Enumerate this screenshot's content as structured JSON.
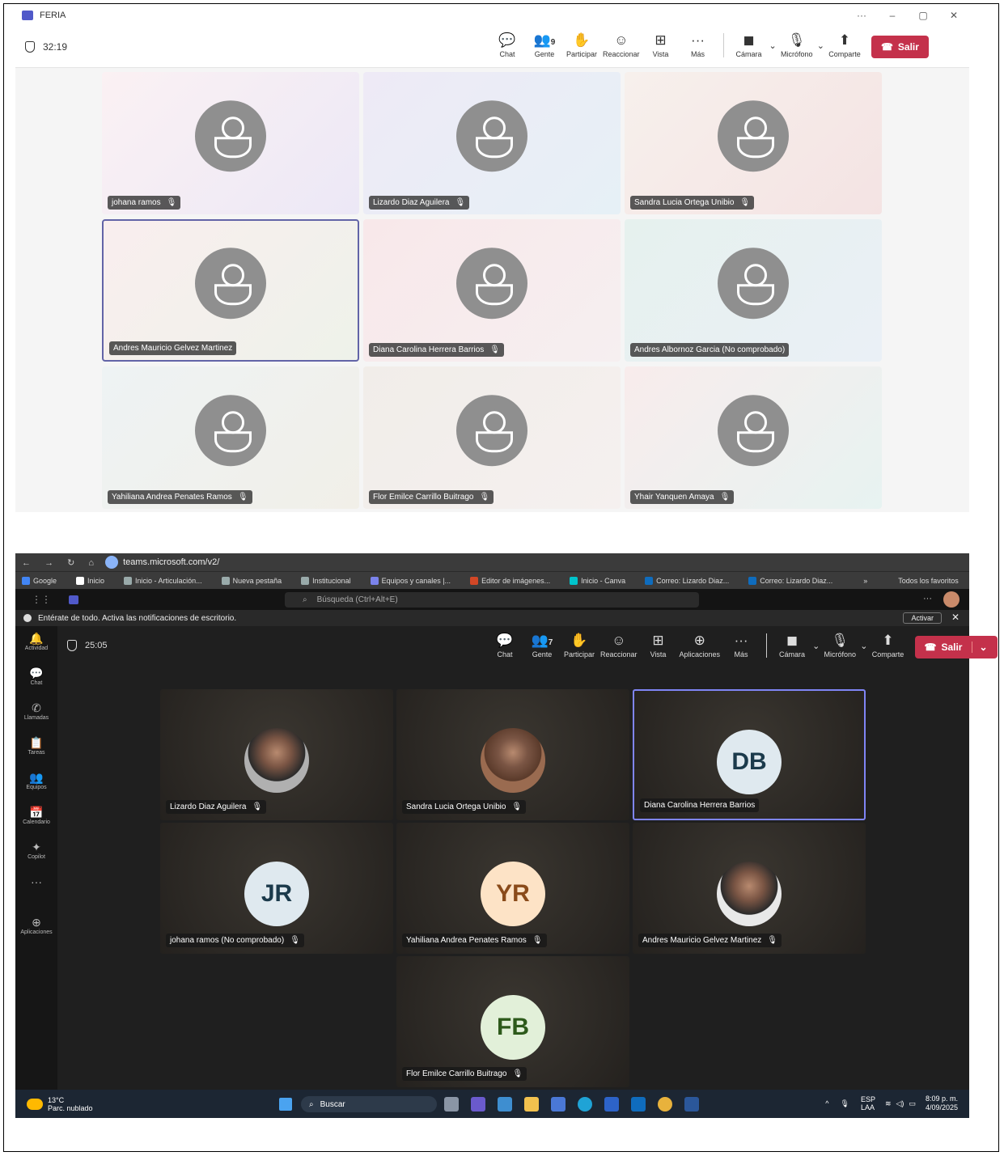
{
  "light": {
    "title": "FERIA",
    "window_controls": [
      "···",
      "–",
      "▢",
      "✕"
    ],
    "timer": "32:19",
    "toolbar": [
      {
        "icon": "chat-icon",
        "glyph": "💬",
        "label": "Chat"
      },
      {
        "icon": "people-icon",
        "glyph": "👥",
        "label": "Gente",
        "count": "9"
      },
      {
        "icon": "hand-icon",
        "glyph": "✋",
        "label": "Participar"
      },
      {
        "icon": "smile-icon",
        "glyph": "☺",
        "label": "Reaccionar"
      },
      {
        "icon": "grid-icon",
        "glyph": "⊞",
        "label": "Vista"
      },
      {
        "icon": "more-icon",
        "glyph": "···",
        "label": "Más"
      }
    ],
    "media": [
      {
        "icon": "camera-off-icon",
        "glyph": "◼",
        "label": "Cámara"
      },
      {
        "icon": "mic-off-icon",
        "glyph": "🎙",
        "label": "Micrófono"
      },
      {
        "icon": "share-icon",
        "glyph": "⬆",
        "label": "Comparte"
      }
    ],
    "leave_label": "Salir",
    "participants": [
      "johana ramos",
      "Lizardo Diaz Aguilera",
      "Sandra Lucia Ortega Unibio",
      "Andres Mauricio Gelvez Martinez",
      "Diana Carolina Herrera Barrios",
      "Andres Albornoz Garcia (No comprobado)",
      "Yahiliana Andrea Penates Ramos",
      "Flor Emilce Carrillo Buitrago",
      "Yhair Yanquen Amaya"
    ]
  },
  "dark": {
    "url": "teams.microsoft.com/v2/",
    "bookmarks": [
      "Google",
      "Inicio",
      "Inicio - Articulación...",
      "Nueva pestaña",
      "Institucional",
      "Equipos y canales |...",
      "Editor de imágenes...",
      "Inicio - Canva",
      "Correo: Lizardo Diaz...",
      "Correo: Lizardo Diaz...",
      "»",
      "Todos los favoritos"
    ],
    "search_placeholder": "Búsqueda (Ctrl+Alt+E)",
    "notice": "Entérate de todo. Activa las notificaciones de escritorio.",
    "notice_button": "Activar",
    "rail": [
      {
        "icon": "bell-icon",
        "glyph": "🔔",
        "label": "Actividad"
      },
      {
        "icon": "chat-icon",
        "glyph": "💬",
        "label": "Chat"
      },
      {
        "icon": "phone-icon",
        "glyph": "✆",
        "label": "Llamadas"
      },
      {
        "icon": "tasks-icon",
        "glyph": "📋",
        "label": "Tareas"
      },
      {
        "icon": "teams-icon",
        "glyph": "👥",
        "label": "Equipos"
      },
      {
        "icon": "calendar-icon",
        "glyph": "📅",
        "label": "Calendario"
      },
      {
        "icon": "copilot-icon",
        "glyph": "✦",
        "label": "Copilot"
      },
      {
        "icon": "more-icon",
        "glyph": "···",
        "label": ""
      },
      {
        "icon": "apps-icon",
        "glyph": "⊕",
        "label": "Aplicaciones"
      }
    ],
    "timer": "25:05",
    "toolbar": [
      {
        "icon": "chat-icon",
        "glyph": "💬",
        "label": "Chat"
      },
      {
        "icon": "people-icon",
        "glyph": "👥",
        "label": "Gente",
        "count": "7"
      },
      {
        "icon": "hand-icon",
        "glyph": "✋",
        "label": "Participar"
      },
      {
        "icon": "smile-icon",
        "glyph": "☺",
        "label": "Reaccionar"
      },
      {
        "icon": "grid-icon",
        "glyph": "⊞",
        "label": "Vista"
      },
      {
        "icon": "apps-icon",
        "glyph": "⊕",
        "label": "Aplicaciones"
      },
      {
        "icon": "more-icon",
        "glyph": "···",
        "label": "Más"
      }
    ],
    "media": [
      {
        "icon": "camera-off-icon",
        "glyph": "◼",
        "label": "Cámara"
      },
      {
        "icon": "mic-off-icon",
        "glyph": "🎙",
        "label": "Micrófono"
      },
      {
        "icon": "share-icon",
        "glyph": "⬆",
        "label": "Comparte"
      }
    ],
    "leave_label": "Salir",
    "participants": [
      {
        "name": "Lizardo Diaz Aguilera",
        "initials": "",
        "color": "#b0b0b0"
      },
      {
        "name": "Sandra Lucia Ortega Unibio",
        "initials": "",
        "color": "#9a6b50"
      },
      {
        "name": "Diana Carolina Herrera Barrios",
        "initials": "DB",
        "color": "#dfe9ef"
      },
      {
        "name": "johana ramos (No comprobado)",
        "initials": "JR",
        "color": "#dfe9ef"
      },
      {
        "name": "Yahiliana Andrea Penates Ramos",
        "initials": "YR",
        "color": "#fde3c6"
      },
      {
        "name": "Andres Mauricio Gelvez Martinez",
        "initials": "",
        "color": "#e8e8e8"
      },
      {
        "name": "Flor Emilce Carrillo Buitrago",
        "initials": "FB",
        "color": "#e2f0d9"
      }
    ],
    "taskbar": {
      "temp": "13°C",
      "weather": "Parc. nublado",
      "search": "Buscar",
      "lang1": "ESP",
      "lang2": "LAA",
      "time": "8:09 p. m.",
      "date": "4/09/2025"
    }
  }
}
